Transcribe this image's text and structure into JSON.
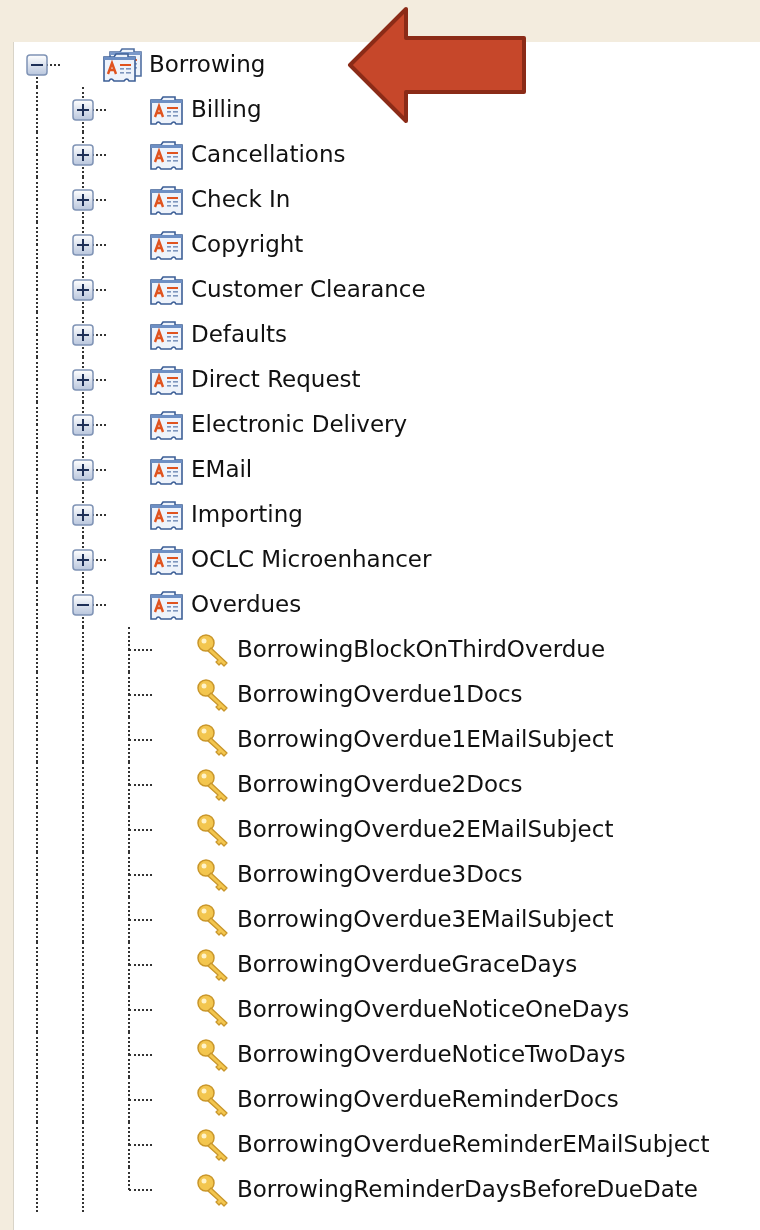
{
  "tree": [
    {
      "label": "Borrowing",
      "kind": "group",
      "expanded": true,
      "children": [
        {
          "label": "Billing",
          "kind": "section",
          "expanded": false
        },
        {
          "label": "Cancellations",
          "kind": "section",
          "expanded": false
        },
        {
          "label": "Check In",
          "kind": "section",
          "expanded": false
        },
        {
          "label": "Copyright",
          "kind": "section",
          "expanded": false
        },
        {
          "label": "Customer Clearance",
          "kind": "section",
          "expanded": false
        },
        {
          "label": "Defaults",
          "kind": "section",
          "expanded": false
        },
        {
          "label": "Direct Request",
          "kind": "section",
          "expanded": false
        },
        {
          "label": "Electronic Delivery",
          "kind": "section",
          "expanded": false
        },
        {
          "label": "EMail",
          "kind": "section",
          "expanded": false
        },
        {
          "label": "Importing",
          "kind": "section",
          "expanded": false
        },
        {
          "label": "OCLC Microenhancer",
          "kind": "section",
          "expanded": false
        },
        {
          "label": "Overdues",
          "kind": "section",
          "expanded": true,
          "children": [
            {
              "label": "BorrowingBlockOnThirdOverdue",
              "kind": "setting"
            },
            {
              "label": "BorrowingOverdue1Docs",
              "kind": "setting"
            },
            {
              "label": "BorrowingOverdue1EMailSubject",
              "kind": "setting"
            },
            {
              "label": "BorrowingOverdue2Docs",
              "kind": "setting"
            },
            {
              "label": "BorrowingOverdue2EMailSubject",
              "kind": "setting"
            },
            {
              "label": "BorrowingOverdue3Docs",
              "kind": "setting"
            },
            {
              "label": "BorrowingOverdue3EMailSubject",
              "kind": "setting"
            },
            {
              "label": "BorrowingOverdueGraceDays",
              "kind": "setting"
            },
            {
              "label": "BorrowingOverdueNoticeOneDays",
              "kind": "setting"
            },
            {
              "label": "BorrowingOverdueNoticeTwoDays",
              "kind": "setting"
            },
            {
              "label": "BorrowingOverdueReminderDocs",
              "kind": "setting"
            },
            {
              "label": "BorrowingOverdueReminderEMailSubject",
              "kind": "setting"
            },
            {
              "label": "BorrowingReminderDaysBeforeDueDate",
              "kind": "setting"
            }
          ]
        }
      ]
    }
  ]
}
